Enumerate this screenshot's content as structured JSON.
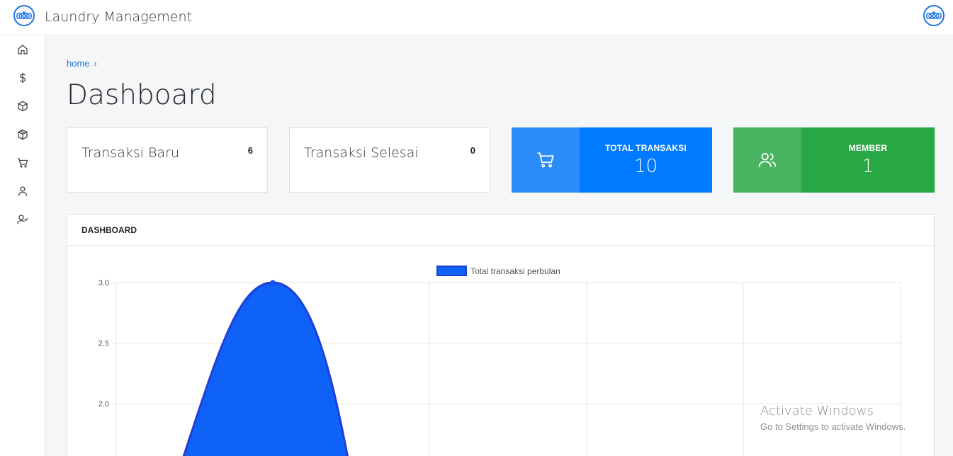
{
  "app": {
    "title": "Laundry Management"
  },
  "sidebar": {
    "items": [
      {
        "icon": "home-icon"
      },
      {
        "icon": "dollar-icon"
      },
      {
        "icon": "box-icon"
      },
      {
        "icon": "package-icon"
      },
      {
        "icon": "cart-icon"
      },
      {
        "icon": "user-icon"
      },
      {
        "icon": "user-check-icon"
      }
    ]
  },
  "breadcrumb": {
    "home": "home",
    "separator": "›"
  },
  "page": {
    "title": "Dashboard"
  },
  "cards": {
    "transaksi_baru": {
      "label": "Transaksi Baru",
      "value": "6"
    },
    "transaksi_selesai": {
      "label": "Transaksi Selesai",
      "value": "0"
    }
  },
  "tiles": {
    "total_transaksi": {
      "title": "TOTAL TRANSAKSI",
      "value": "10",
      "color_light": "#2a8df7",
      "color": "#007bff"
    },
    "member": {
      "title": "MEMBER",
      "value": "1",
      "color_light": "#48b461",
      "color": "#28a745"
    }
  },
  "panel": {
    "title": "DASHBOARD"
  },
  "chart_data": {
    "type": "area",
    "series": [
      {
        "name": "Total transaksi perbulan",
        "color": "#0f62f7",
        "border": "#1f3fd6",
        "x": [
          1
        ],
        "values": [
          3.0
        ]
      }
    ],
    "y_ticks": [
      "3.0",
      "2.5",
      "2.0"
    ],
    "ylim_visible": [
      1.7,
      3.0
    ],
    "grid": true,
    "legend": "top-center"
  },
  "watermark": {
    "line1": "Activate Windows",
    "line2": "Go to Settings to activate Windows."
  }
}
